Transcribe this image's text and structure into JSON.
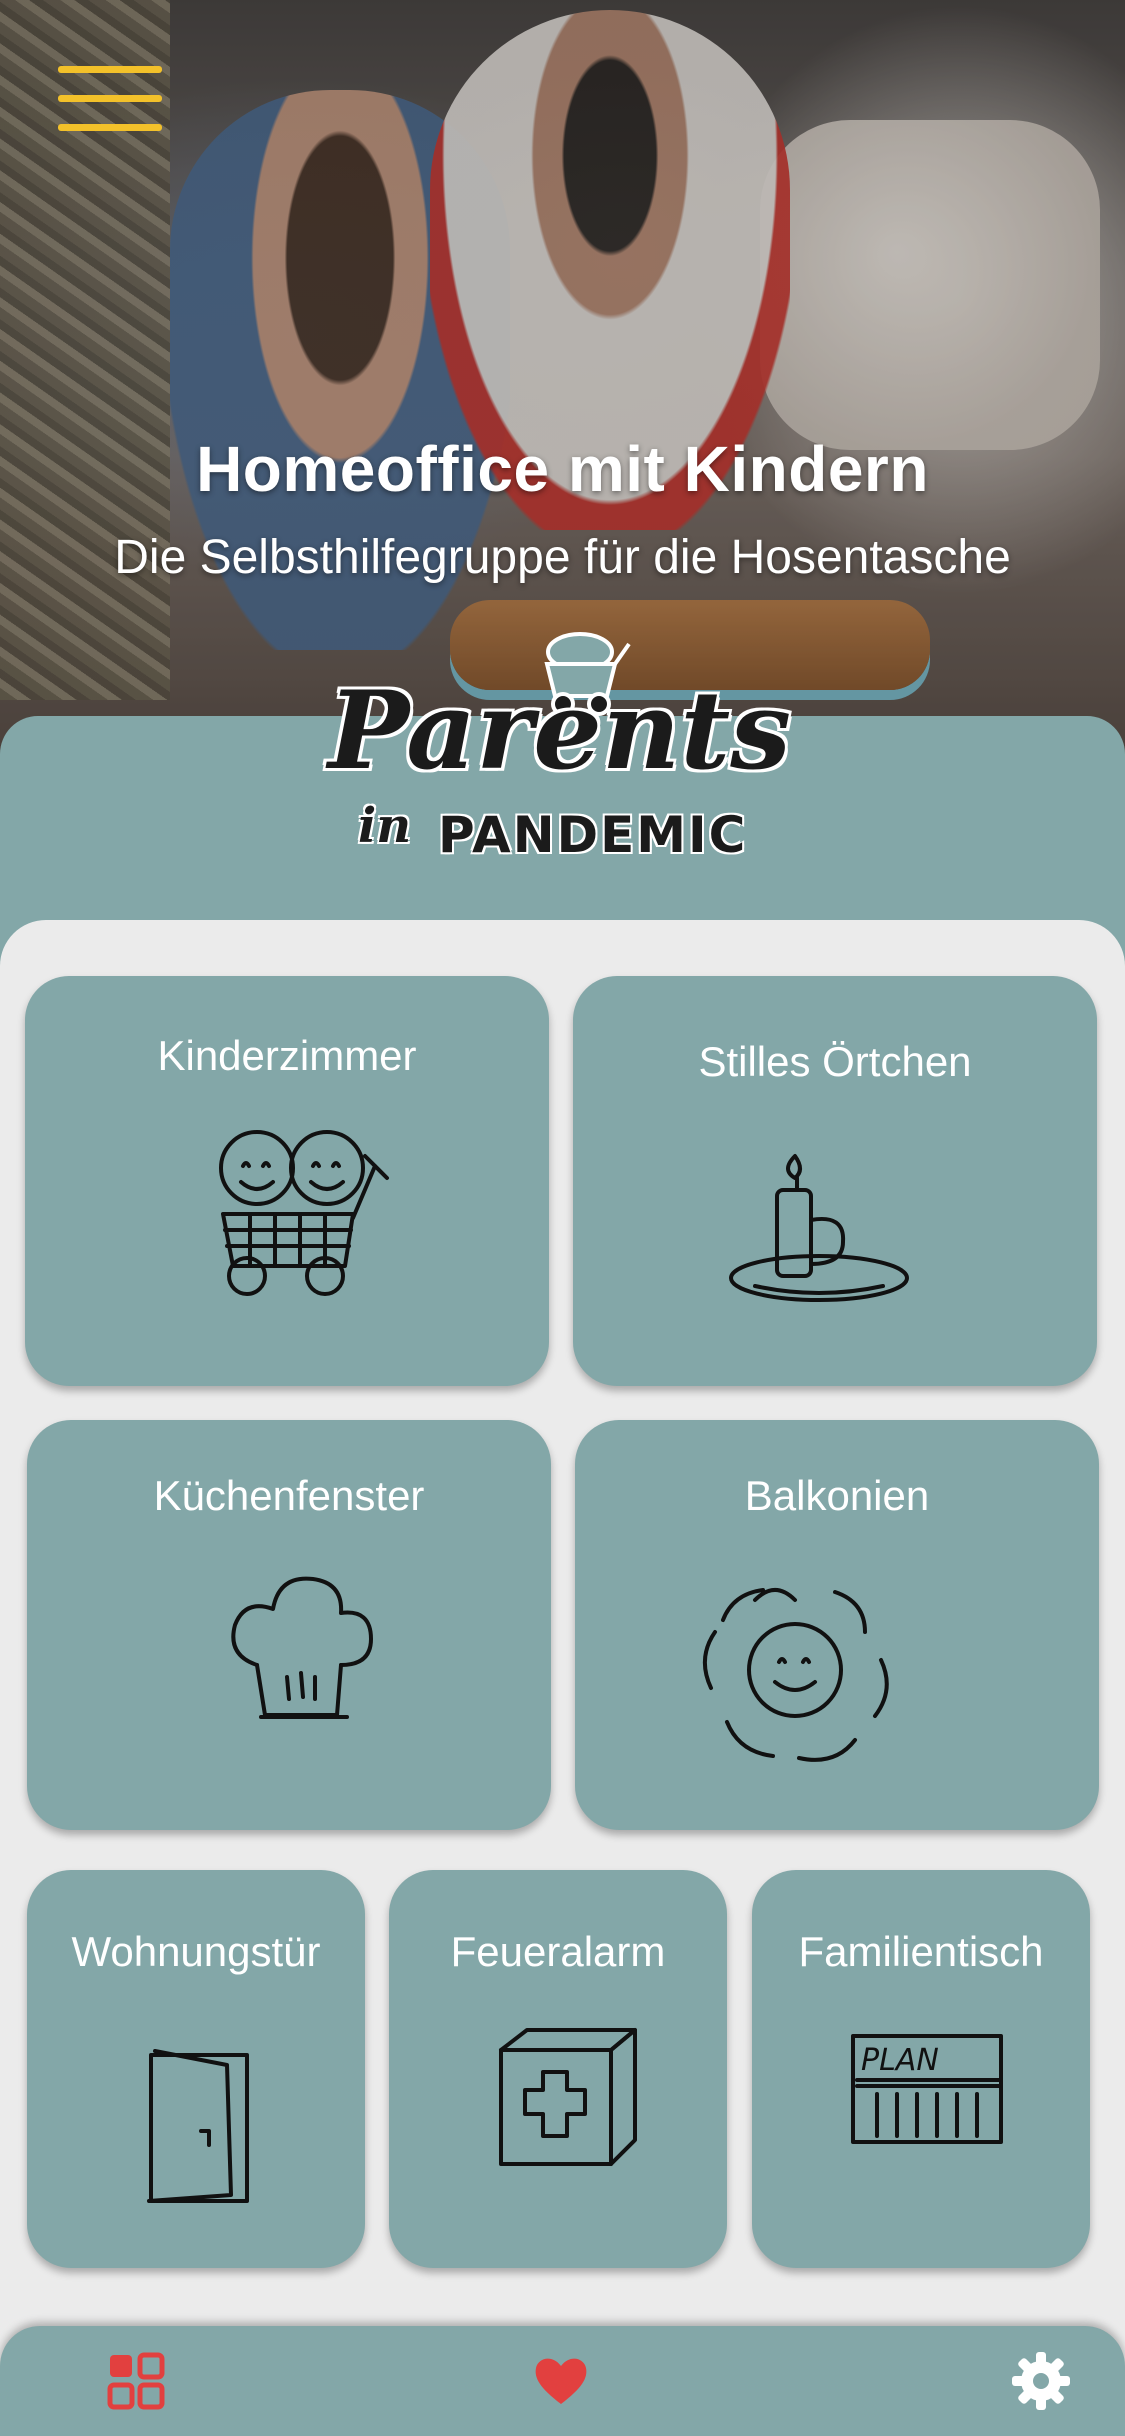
{
  "header": {
    "title": "Homeoffice mit Kindern",
    "subtitle": "Die Selbsthilfegruppe für die Hosentasche",
    "menu_icon": "hamburger-menu-icon",
    "menu_color": "#f3c12a"
  },
  "logo": {
    "line1": "Parents",
    "line2_small": "in",
    "line2_big": "PANDEMIC"
  },
  "rooms": [
    {
      "label": "Kinderzimmer",
      "icon": "kids-wagon-icon"
    },
    {
      "label": "Stilles Örtchen",
      "icon": "candle-icon"
    },
    {
      "label": "Küchenfenster",
      "icon": "chef-hat-icon"
    },
    {
      "label": "Balkonien",
      "icon": "sun-icon"
    },
    {
      "label": "Wohnungstür",
      "icon": "door-icon"
    },
    {
      "label": "Feueralarm",
      "icon": "first-aid-kit-icon"
    },
    {
      "label": "Familientisch",
      "icon": "plan-board-icon",
      "icon_text": "PLAN"
    }
  ],
  "bottom_nav": {
    "items": [
      {
        "name": "dashboard",
        "icon": "grid-icon",
        "color": "#e2403f"
      },
      {
        "name": "favorites",
        "icon": "heart-icon",
        "color": "#e2403f"
      },
      {
        "name": "settings",
        "icon": "gear-icon",
        "color": "#ffffff"
      }
    ]
  },
  "colors": {
    "teal": "#83a7a8",
    "background": "#ebebeb",
    "accent_red": "#e2403f",
    "accent_yellow": "#f3c12a"
  }
}
